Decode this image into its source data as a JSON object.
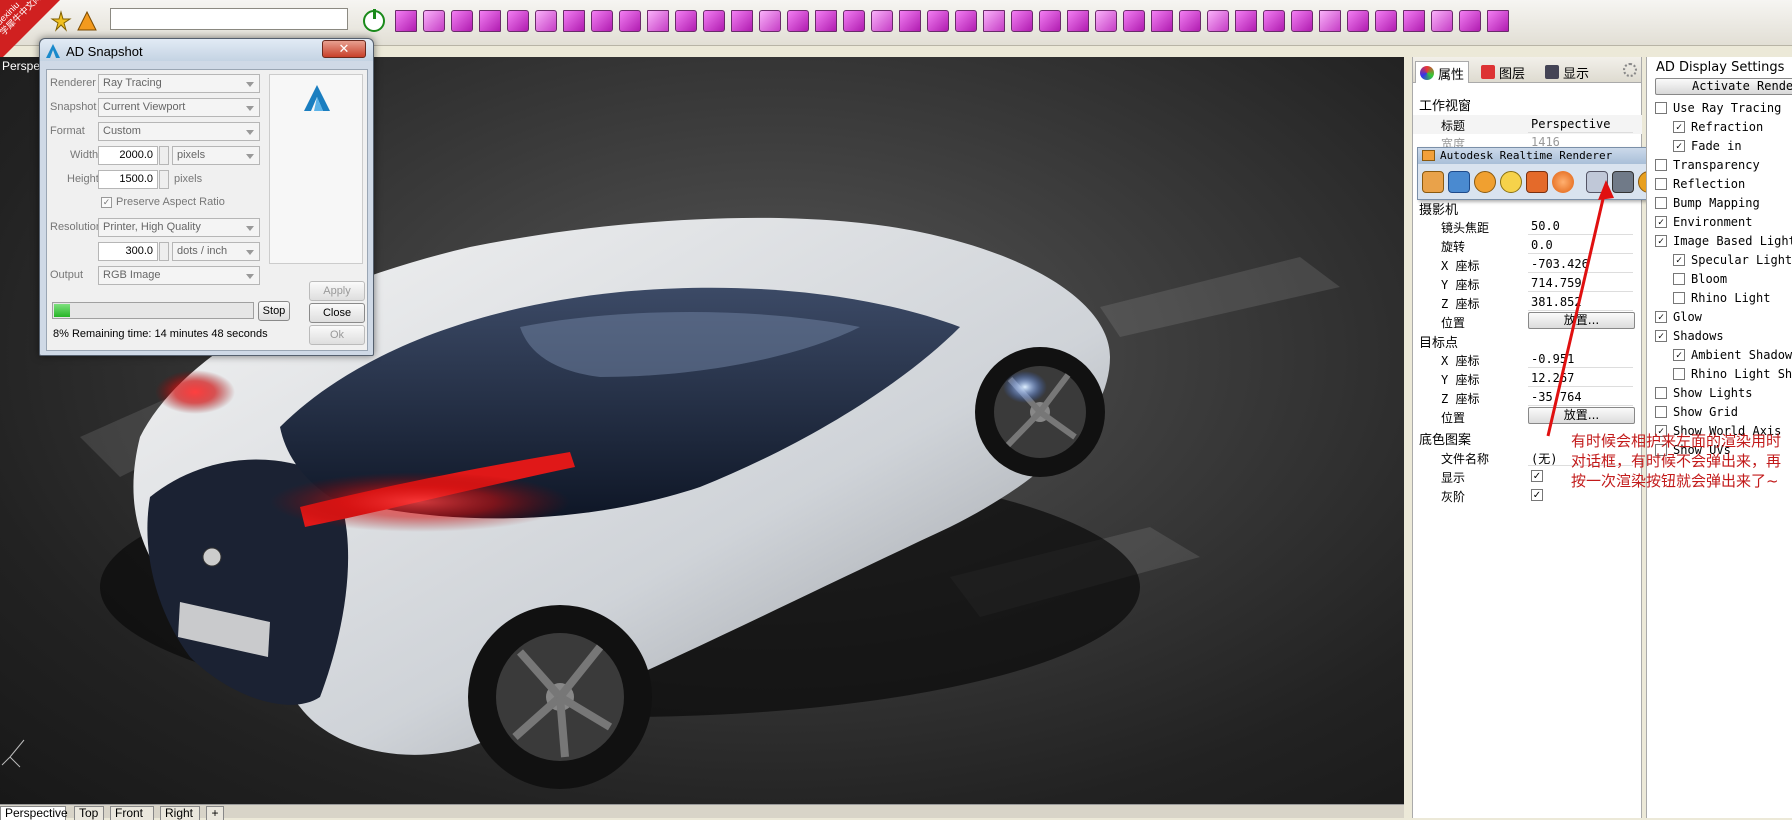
{
  "watermark": {
    "line1": "xuexiniu",
    "line2": "学犀牛中文网"
  },
  "viewport": {
    "label": "Perspe",
    "tabs": [
      "Perspective",
      "Top",
      "Front",
      "Right"
    ]
  },
  "snapshot_dialog": {
    "title": "AD Snapshot",
    "close_glyph": "✕",
    "renderer_label": "Renderer",
    "renderer_value": "Ray Tracing",
    "snapshot_label": "Snapshot",
    "snapshot_value": "Current Viewport",
    "format_label": "Format",
    "format_value": "Custom",
    "width_label": "Width",
    "width_value": "2000.0",
    "width_unit": "pixels",
    "height_label": "Height",
    "height_value": "1500.0",
    "height_unit": "pixels",
    "preserve_label": "Preserve Aspect Ratio",
    "preserve_checked": true,
    "resolution_label": "Resolution",
    "resolution_value": "Printer, High Quality",
    "dpi_value": "300.0",
    "dpi_unit": "dots / inch",
    "output_label": "Output",
    "output_value": "RGB Image",
    "apply_label": "Apply",
    "close_label": "Close",
    "ok_label": "Ok",
    "stop_label": "Stop",
    "progress": 0.08,
    "status": "8% Remaining time: 14 minutes 48 seconds"
  },
  "properties_panel": {
    "tabs": [
      {
        "label": "属性",
        "icon": "properties-icon"
      },
      {
        "label": "图层",
        "icon": "layers-icon"
      },
      {
        "label": "显示",
        "icon": "display-icon"
      }
    ],
    "section_viewport": "工作视窗",
    "title_key": "标题",
    "title_value": "Perspective",
    "width_key": "宽度",
    "width_value": "1416",
    "camera_section": "摄影机",
    "focal_key": "镜头焦距",
    "focal_value": "50.0",
    "rotation_key": "旋转",
    "rotation_value": "0.0",
    "cam_x_key": "X 座标",
    "cam_x_value": "-703.426",
    "cam_y_key": "Y 座标",
    "cam_y_value": "714.759",
    "cam_z_key": "Z 座标",
    "cam_z_value": "381.852",
    "cam_pos_key": "位置",
    "cam_pos_btn": "放置...",
    "target_section": "目标点",
    "tgt_x_key": "X 座标",
    "tgt_x_value": "-0.951",
    "tgt_y_key": "Y 座标",
    "tgt_y_value": "12.267",
    "tgt_z_key": "Z 座标",
    "tgt_z_value": "-35.764",
    "tgt_pos_key": "位置",
    "tgt_pos_btn": "放置...",
    "wallpaper_section": "底色图案",
    "filename_key": "文件名称",
    "filename_value": "(无)",
    "show_key": "显示",
    "show_checked": true,
    "gray_key": "灰阶",
    "gray_checked": true
  },
  "realtime_renderer": {
    "title": "Autodesk Realtime Renderer"
  },
  "ad_display": {
    "title": "AD Display Settings",
    "activate_btn": "Activate Render",
    "items": [
      {
        "label": "Use Ray Tracing",
        "checked": false,
        "indent": 0
      },
      {
        "label": "Refraction",
        "checked": true,
        "indent": 1
      },
      {
        "label": "Fade in",
        "checked": true,
        "indent": 1
      },
      {
        "label": "Transparency",
        "checked": false,
        "indent": 0
      },
      {
        "label": "Reflection",
        "checked": false,
        "indent": 0
      },
      {
        "label": "Bump Mapping",
        "checked": false,
        "indent": 0
      },
      {
        "label": "Environment",
        "checked": true,
        "indent": 0
      },
      {
        "label": "Image Based Lighting",
        "checked": true,
        "indent": 0
      },
      {
        "label": "Specular Lighting",
        "checked": true,
        "indent": 1
      },
      {
        "label": "Bloom",
        "checked": false,
        "indent": 1
      },
      {
        "label": "Rhino Light",
        "checked": false,
        "indent": 1
      },
      {
        "label": "Glow",
        "checked": true,
        "indent": 0
      },
      {
        "label": "Shadows",
        "checked": true,
        "indent": 0
      },
      {
        "label": "Ambient Shadows",
        "checked": true,
        "indent": 1
      },
      {
        "label": "Rhino Light Shadows",
        "checked": false,
        "indent": 1
      },
      {
        "label": "Show Lights",
        "checked": false,
        "indent": 0
      },
      {
        "label": "Show Grid",
        "checked": false,
        "indent": 0
      },
      {
        "label": "Show World Axis",
        "checked": true,
        "indent": 0
      },
      {
        "label": "Show UVs",
        "checked": false,
        "indent": 0
      }
    ]
  },
  "annotation": "有时候会相护来左面的渲染用时对话框，有时候不会弹出来，再按一次渲染按钮就会弹出来了~",
  "colors": {
    "accent_magenta": "#c53ec5",
    "note_red": "#c21a1a",
    "progress_green": "#26b526"
  }
}
